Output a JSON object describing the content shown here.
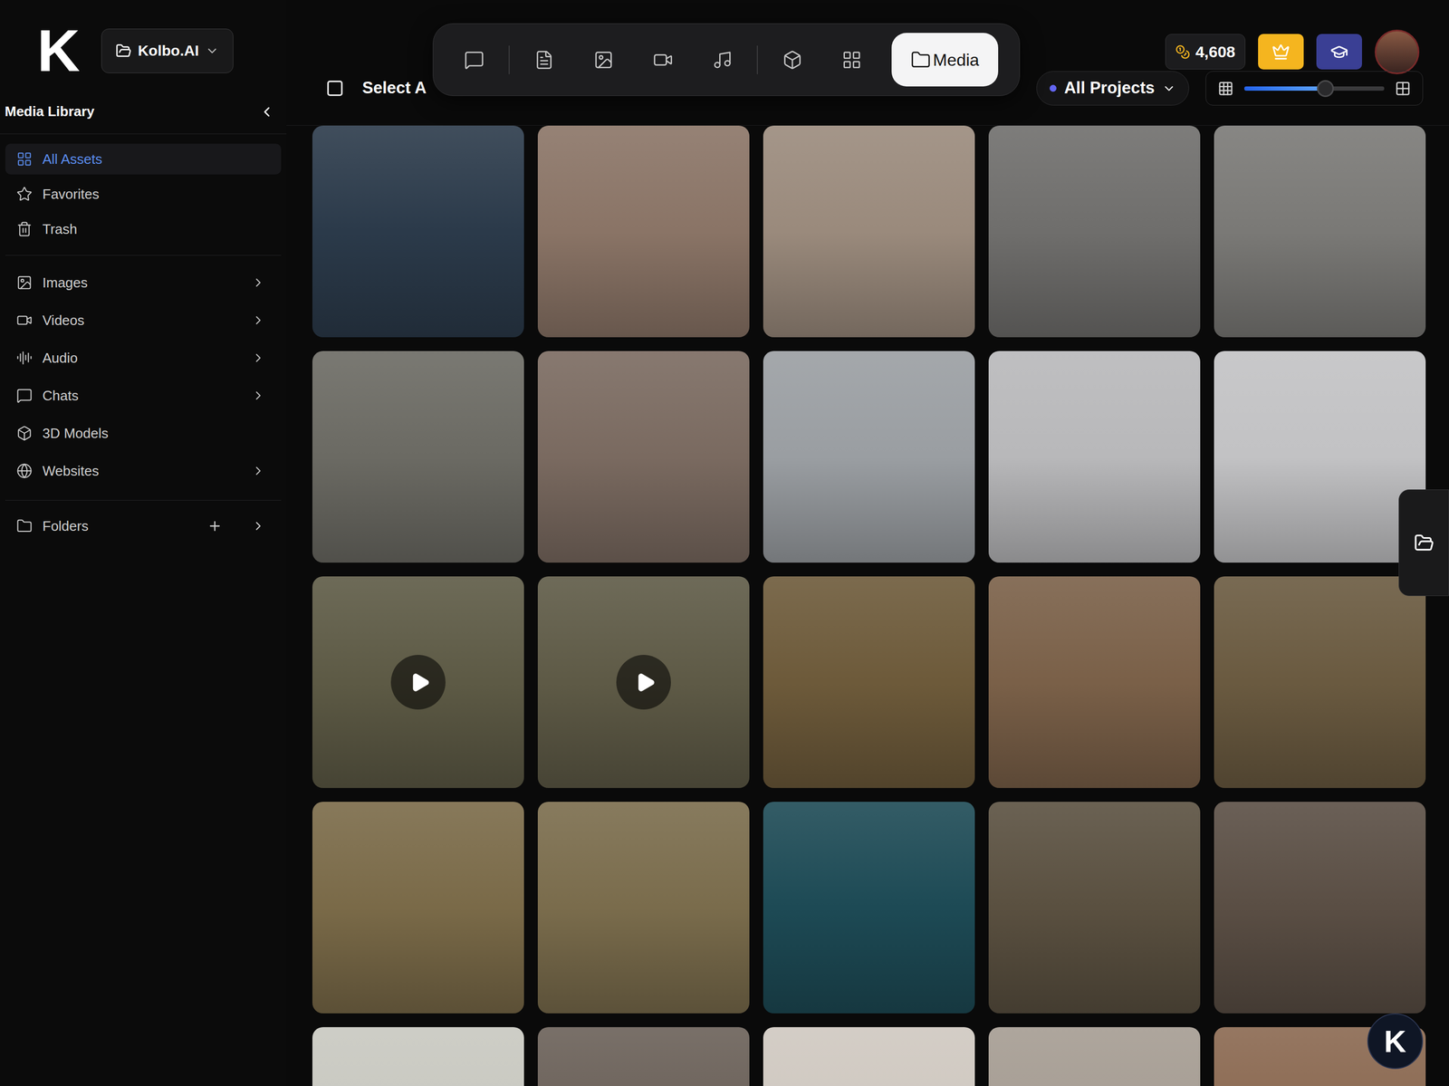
{
  "app": {
    "logo": "K",
    "project": "Kolbo.AI"
  },
  "sidebar": {
    "title": "Media Library",
    "sections": [
      [
        {
          "label": "All Assets",
          "selected": true,
          "expandable": false
        },
        {
          "label": "Favorites",
          "selected": false,
          "expandable": false
        },
        {
          "label": "Trash",
          "selected": false,
          "expandable": false
        }
      ],
      [
        {
          "label": "Images",
          "selected": false,
          "expandable": true
        },
        {
          "label": "Videos",
          "selected": false,
          "expandable": true
        },
        {
          "label": "Audio",
          "selected": false,
          "expandable": true
        },
        {
          "label": "Chats",
          "selected": false,
          "expandable": true
        },
        {
          "label": "3D Models",
          "selected": false,
          "expandable": false
        },
        {
          "label": "Websites",
          "selected": false,
          "expandable": true
        }
      ]
    ],
    "folders": {
      "label": "Folders",
      "expandable": true
    }
  },
  "toolbar": {
    "tabs": [
      {
        "selected": false
      },
      {
        "selected": false
      },
      {
        "selected": false
      },
      {
        "selected": false
      },
      {
        "selected": false
      },
      {
        "selected": false
      },
      {
        "selected": false
      },
      {
        "label": "Media",
        "selected": true
      }
    ]
  },
  "header": {
    "select_all": {
      "label": "Select A",
      "checked": false
    },
    "credits": "4,608",
    "project_filter": {
      "label": "All Projects"
    },
    "size_slider": {
      "level": 0.58
    }
  },
  "assets": [
    {
      "kind": "image",
      "color": "#2b3a4a"
    },
    {
      "kind": "image",
      "color": "#8a7466"
    },
    {
      "kind": "image",
      "color": "#9a8a7c"
    },
    {
      "kind": "image",
      "color": "#6f6e6c"
    },
    {
      "kind": "image",
      "color": "#7a7976"
    },
    {
      "kind": "image",
      "color": "#6b6a63"
    },
    {
      "kind": "image",
      "color": "#7a6a60"
    },
    {
      "kind": "image",
      "color": "#9a9ea2"
    },
    {
      "kind": "image",
      "color": "#b8b8ba"
    },
    {
      "kind": "image",
      "color": "#c2c2c4"
    },
    {
      "kind": "video",
      "color": "#5d5a45"
    },
    {
      "kind": "video",
      "color": "#5e5a46"
    },
    {
      "kind": "image",
      "color": "#6d5a3a"
    },
    {
      "kind": "image",
      "color": "#7a6048"
    },
    {
      "kind": "image",
      "color": "#6a5a40"
    },
    {
      "kind": "image",
      "color": "#7a6a48"
    },
    {
      "kind": "image",
      "color": "#7a6c4c"
    },
    {
      "kind": "image",
      "color": "#1d4a55"
    },
    {
      "kind": "image",
      "color": "#5a5040"
    },
    {
      "kind": "image",
      "color": "#5a4e44"
    },
    {
      "kind": "image",
      "color": "#c8c8c0"
    },
    {
      "kind": "image",
      "color": "#6a6058"
    },
    {
      "kind": "image",
      "color": "#cfc8c0"
    },
    {
      "kind": "image",
      "color": "#a59c92"
    },
    {
      "kind": "image",
      "color": "#8a6850"
    }
  ],
  "assistant": {
    "logo": "K"
  }
}
